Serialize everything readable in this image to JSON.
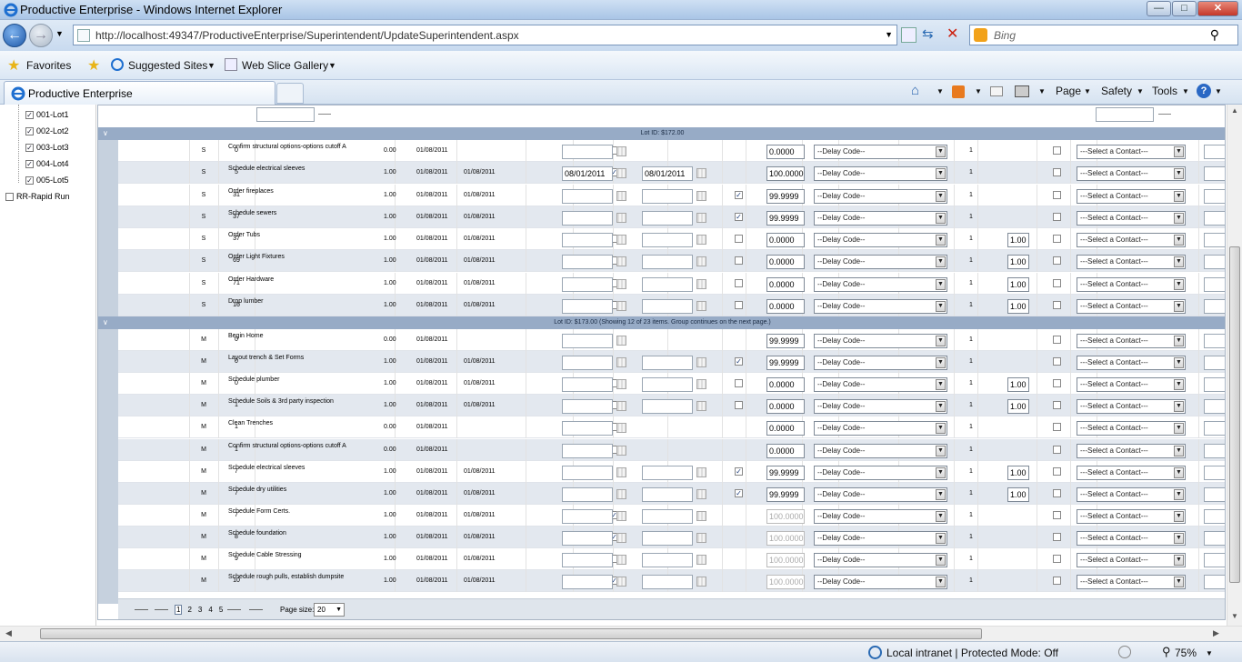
{
  "window": {
    "title": "Productive Enterprise - Windows Internet Explorer"
  },
  "address": {
    "url": "http://localhost:49347/ProductiveEnterprise/Superintendent/UpdateSuperintendent.aspx",
    "search_placeholder": "Bing"
  },
  "favorites": {
    "favorites_label": "Favorites",
    "suggested": "Suggested Sites",
    "webslice": "Web Slice Gallery"
  },
  "tab": {
    "label": "Productive Enterprise"
  },
  "commandbar": {
    "page": "Page",
    "safety": "Safety",
    "tools": "Tools"
  },
  "tree": [
    {
      "label": "001-Lot1",
      "checked": true
    },
    {
      "label": "002-Lot2",
      "checked": true
    },
    {
      "label": "003-Lot3",
      "checked": true
    },
    {
      "label": "004-Lot4",
      "checked": true
    },
    {
      "label": "005-Lot5",
      "checked": true
    },
    {
      "label": "RR-Rapid Run",
      "checked": false
    }
  ],
  "groups": [
    {
      "label": "Lot ID: $172.00"
    },
    {
      "label": "Lot ID: $173.00 (Showing 12 of 23 items. Group continues on the next page.)"
    }
  ],
  "rows": [
    {
      "type": "S",
      "seq": "0",
      "desc": "Confirm structural options-options cutoff A",
      "days": "0.00",
      "d1": "01/08/2011",
      "d2": "",
      "cb1": "false",
      "start": "",
      "end": "",
      "showEnd": false,
      "cb2": "",
      "pct": "0.0000",
      "pctDis": false,
      "delay": "--Delay Code--",
      "num": "1",
      "hr": "",
      "cb3": false,
      "contact": "---Select a Contact---",
      "alt": false
    },
    {
      "type": "S",
      "seq": "5",
      "desc": "Schedule electrical sleeves",
      "days": "1.00",
      "d1": "01/08/2011",
      "d2": "01/08/2011",
      "cb1": "true",
      "start": "08/01/2011",
      "end": "08/01/2011",
      "showEnd": true,
      "cb2": "",
      "pct": "100.0000",
      "pctDis": false,
      "delay": "--Delay Code--",
      "num": "1",
      "hr": "",
      "cb3": false,
      "contact": "---Select a Contact---",
      "alt": true
    },
    {
      "type": "S",
      "seq": "31",
      "desc": "Order fireplaces",
      "days": "1.00",
      "d1": "01/08/2011",
      "d2": "01/08/2011",
      "cb1": "",
      "start": "",
      "end": "",
      "showEnd": true,
      "cb2": "true",
      "pct": "99.9999",
      "pctDis": false,
      "delay": "--Delay Code--",
      "num": "1",
      "hr": "",
      "cb3": false,
      "contact": "---Select a Contact---",
      "alt": false
    },
    {
      "type": "S",
      "seq": "37",
      "desc": "Schedule sewers",
      "days": "1.00",
      "d1": "01/08/2011",
      "d2": "01/08/2011",
      "cb1": "",
      "start": "",
      "end": "",
      "showEnd": true,
      "cb2": "true",
      "pct": "99.9999",
      "pctDis": false,
      "delay": "--Delay Code--",
      "num": "1",
      "hr": "",
      "cb3": false,
      "contact": "---Select a Contact---",
      "alt": true
    },
    {
      "type": "S",
      "seq": "37",
      "desc": "Order Tubs",
      "days": "1.00",
      "d1": "01/08/2011",
      "d2": "01/08/2011",
      "cb1": "false",
      "start": "",
      "end": "",
      "showEnd": true,
      "cb2": "false",
      "pct": "0.0000",
      "pctDis": false,
      "delay": "--Delay Code--",
      "num": "1",
      "hr": "1.00",
      "cb3": false,
      "contact": "---Select a Contact---",
      "alt": false
    },
    {
      "type": "S",
      "seq": "69",
      "desc": "Order Light Fixtures",
      "days": "1.00",
      "d1": "01/08/2011",
      "d2": "01/08/2011",
      "cb1": "false",
      "start": "",
      "end": "",
      "showEnd": true,
      "cb2": "false",
      "pct": "0.0000",
      "pctDis": false,
      "delay": "--Delay Code--",
      "num": "1",
      "hr": "1.00",
      "cb3": false,
      "contact": "---Select a Contact---",
      "alt": true
    },
    {
      "type": "S",
      "seq": "71",
      "desc": "Order Hardware",
      "days": "1.00",
      "d1": "01/08/2011",
      "d2": "01/08/2011",
      "cb1": "false",
      "start": "",
      "end": "",
      "showEnd": true,
      "cb2": "false",
      "pct": "0.0000",
      "pctDis": false,
      "delay": "--Delay Code--",
      "num": "1",
      "hr": "1.00",
      "cb3": false,
      "contact": "---Select a Contact---",
      "alt": false
    },
    {
      "type": "S",
      "seq": "16",
      "desc": "Drop lumber",
      "days": "1.00",
      "d1": "01/08/2011",
      "d2": "01/08/2011",
      "cb1": "false",
      "start": "",
      "end": "",
      "showEnd": true,
      "cb2": "false",
      "pct": "0.0000",
      "pctDis": false,
      "delay": "--Delay Code--",
      "num": "1",
      "hr": "1.00",
      "cb3": false,
      "contact": "---Select a Contact---",
      "alt": true
    },
    {
      "type": "M",
      "seq": "0",
      "desc": "Begin Home",
      "days": "0.00",
      "d1": "01/08/2011",
      "d2": "",
      "cb1": "",
      "start": "",
      "end": "",
      "showEnd": false,
      "cb2": "",
      "pct": "99.9999",
      "pctDis": false,
      "delay": "--Delay Code--",
      "num": "1",
      "hr": "",
      "cb3": false,
      "contact": "---Select a Contact---",
      "alt": false
    },
    {
      "type": "M",
      "seq": "0",
      "desc": "Layout trench & Set Forms",
      "days": "1.00",
      "d1": "01/08/2011",
      "d2": "01/08/2011",
      "cb1": "",
      "start": "",
      "end": "",
      "showEnd": true,
      "cb2": "true",
      "pct": "99.9999",
      "pctDis": false,
      "delay": "--Delay Code--",
      "num": "1",
      "hr": "",
      "cb3": false,
      "contact": "---Select a Contact---",
      "alt": true
    },
    {
      "type": "M",
      "seq": "0",
      "desc": "Schedule plumber",
      "days": "1.00",
      "d1": "01/08/2011",
      "d2": "01/08/2011",
      "cb1": "false",
      "start": "",
      "end": "",
      "showEnd": true,
      "cb2": "false",
      "pct": "0.0000",
      "pctDis": false,
      "delay": "--Delay Code--",
      "num": "1",
      "hr": "1.00",
      "cb3": false,
      "contact": "---Select a Contact---",
      "alt": false
    },
    {
      "type": "M",
      "seq": "1",
      "desc": "Schedule Soils & 3rd party inspection",
      "days": "1.00",
      "d1": "01/08/2011",
      "d2": "01/08/2011",
      "cb1": "false",
      "start": "",
      "end": "",
      "showEnd": true,
      "cb2": "false",
      "pct": "0.0000",
      "pctDis": false,
      "delay": "--Delay Code--",
      "num": "1",
      "hr": "1.00",
      "cb3": false,
      "contact": "---Select a Contact---",
      "alt": true
    },
    {
      "type": "M",
      "seq": "1",
      "desc": "Clean Trenches",
      "days": "0.00",
      "d1": "01/08/2011",
      "d2": "",
      "cb1": "false",
      "start": "",
      "end": "",
      "showEnd": false,
      "cb2": "",
      "pct": "0.0000",
      "pctDis": false,
      "delay": "--Delay Code--",
      "num": "1",
      "hr": "",
      "cb3": false,
      "contact": "---Select a Contact---",
      "alt": false
    },
    {
      "type": "M",
      "seq": "1",
      "desc": "Confirm structural options-options cutoff A",
      "days": "0.00",
      "d1": "01/08/2011",
      "d2": "",
      "cb1": "false",
      "start": "",
      "end": "",
      "showEnd": false,
      "cb2": "",
      "pct": "0.0000",
      "pctDis": false,
      "delay": "--Delay Code--",
      "num": "1",
      "hr": "",
      "cb3": false,
      "contact": "---Select a Contact---",
      "alt": true
    },
    {
      "type": "M",
      "seq": "7",
      "desc": "Schedule electrical sleeves",
      "days": "1.00",
      "d1": "01/08/2011",
      "d2": "01/08/2011",
      "cb1": "",
      "start": "",
      "end": "",
      "showEnd": true,
      "cb2": "true",
      "pct": "99.9999",
      "pctDis": false,
      "delay": "--Delay Code--",
      "num": "1",
      "hr": "1.00",
      "cb3": false,
      "contact": "---Select a Contact---",
      "alt": false
    },
    {
      "type": "M",
      "seq": "7",
      "desc": "Schedule dry utilities",
      "days": "1.00",
      "d1": "01/08/2011",
      "d2": "01/08/2011",
      "cb1": "",
      "start": "",
      "end": "",
      "showEnd": true,
      "cb2": "true",
      "pct": "99.9999",
      "pctDis": false,
      "delay": "--Delay Code--",
      "num": "1",
      "hr": "1.00",
      "cb3": false,
      "contact": "---Select a Contact---",
      "alt": true
    },
    {
      "type": "M",
      "seq": "7",
      "desc": "Schedule Form Certs.",
      "days": "1.00",
      "d1": "01/08/2011",
      "d2": "01/08/2011",
      "cb1": "true",
      "start": "",
      "end": "",
      "showEnd": true,
      "cb2": "",
      "pct": "100.0000",
      "pctDis": true,
      "delay": "--Delay Code--",
      "num": "1",
      "hr": "",
      "cb3": false,
      "contact": "---Select a Contact---",
      "alt": false
    },
    {
      "type": "M",
      "seq": "8",
      "desc": "Schedule foundation",
      "days": "1.00",
      "d1": "01/08/2011",
      "d2": "01/08/2011",
      "cb1": "true",
      "start": "",
      "end": "",
      "showEnd": true,
      "cb2": "",
      "pct": "100.0000",
      "pctDis": true,
      "delay": "--Delay Code--",
      "num": "1",
      "hr": "",
      "cb3": false,
      "contact": "---Select a Contact---",
      "alt": true
    },
    {
      "type": "M",
      "seq": "9",
      "desc": "Schedule Cable Stressing",
      "days": "1.00",
      "d1": "01/08/2011",
      "d2": "01/08/2011",
      "cb1": "false",
      "start": "",
      "end": "",
      "showEnd": true,
      "cb2": "",
      "pct": "100.0000",
      "pctDis": true,
      "delay": "--Delay Code--",
      "num": "1",
      "hr": "",
      "cb3": false,
      "contact": "---Select a Contact---",
      "alt": false
    },
    {
      "type": "M",
      "seq": "10",
      "desc": "Schedule rough pulls, establish dumpsite",
      "days": "1.00",
      "d1": "01/08/2011",
      "d2": "01/08/2011",
      "cb1": "true",
      "start": "",
      "end": "",
      "showEnd": true,
      "cb2": "",
      "pct": "100.0000",
      "pctDis": true,
      "delay": "--Delay Code--",
      "num": "1",
      "hr": "",
      "cb3": false,
      "contact": "---Select a Contact---",
      "alt": true
    }
  ],
  "pager": {
    "pages": [
      "1",
      "2",
      "3",
      "4",
      "5"
    ],
    "current": "1",
    "size_label": "Page size:",
    "size": "20"
  },
  "status": {
    "zone": "Local intranet | Protected Mode: Off",
    "zoom": "75%"
  }
}
